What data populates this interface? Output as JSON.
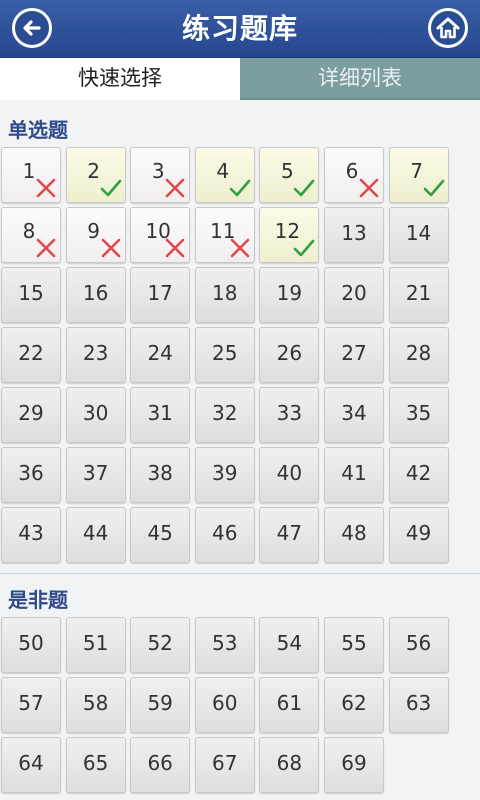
{
  "header": {
    "title": "练习题库",
    "back_icon": "back-arrow-icon",
    "home_icon": "home-icon"
  },
  "tabs": [
    {
      "label": "快速选择",
      "active": true
    },
    {
      "label": "详细列表",
      "active": false
    }
  ],
  "sections": [
    {
      "title": "单选题",
      "questions": [
        {
          "n": "1",
          "s": "wrong"
        },
        {
          "n": "2",
          "s": "right"
        },
        {
          "n": "3",
          "s": "wrong"
        },
        {
          "n": "4",
          "s": "right"
        },
        {
          "n": "5",
          "s": "right"
        },
        {
          "n": "6",
          "s": "wrong"
        },
        {
          "n": "7",
          "s": "right"
        },
        {
          "n": "8",
          "s": "wrong"
        },
        {
          "n": "9",
          "s": "wrong"
        },
        {
          "n": "10",
          "s": "wrong"
        },
        {
          "n": "11",
          "s": "wrong"
        },
        {
          "n": "12",
          "s": "right"
        },
        {
          "n": "13",
          "s": "none"
        },
        {
          "n": "14",
          "s": "none"
        },
        {
          "n": "15",
          "s": "none"
        },
        {
          "n": "16",
          "s": "none"
        },
        {
          "n": "17",
          "s": "none"
        },
        {
          "n": "18",
          "s": "none"
        },
        {
          "n": "19",
          "s": "none"
        },
        {
          "n": "20",
          "s": "none"
        },
        {
          "n": "21",
          "s": "none"
        },
        {
          "n": "22",
          "s": "none"
        },
        {
          "n": "23",
          "s": "none"
        },
        {
          "n": "24",
          "s": "none"
        },
        {
          "n": "25",
          "s": "none"
        },
        {
          "n": "26",
          "s": "none"
        },
        {
          "n": "27",
          "s": "none"
        },
        {
          "n": "28",
          "s": "none"
        },
        {
          "n": "29",
          "s": "none"
        },
        {
          "n": "30",
          "s": "none"
        },
        {
          "n": "31",
          "s": "none"
        },
        {
          "n": "32",
          "s": "none"
        },
        {
          "n": "33",
          "s": "none"
        },
        {
          "n": "34",
          "s": "none"
        },
        {
          "n": "35",
          "s": "none"
        },
        {
          "n": "36",
          "s": "none"
        },
        {
          "n": "37",
          "s": "none"
        },
        {
          "n": "38",
          "s": "none"
        },
        {
          "n": "39",
          "s": "none"
        },
        {
          "n": "40",
          "s": "none"
        },
        {
          "n": "41",
          "s": "none"
        },
        {
          "n": "42",
          "s": "none"
        },
        {
          "n": "43",
          "s": "none"
        },
        {
          "n": "44",
          "s": "none"
        },
        {
          "n": "45",
          "s": "none"
        },
        {
          "n": "46",
          "s": "none"
        },
        {
          "n": "47",
          "s": "none"
        },
        {
          "n": "48",
          "s": "none"
        },
        {
          "n": "49",
          "s": "none"
        }
      ]
    },
    {
      "title": "是非题",
      "questions": [
        {
          "n": "50",
          "s": "none"
        },
        {
          "n": "51",
          "s": "none"
        },
        {
          "n": "52",
          "s": "none"
        },
        {
          "n": "53",
          "s": "none"
        },
        {
          "n": "54",
          "s": "none"
        },
        {
          "n": "55",
          "s": "none"
        },
        {
          "n": "56",
          "s": "none"
        },
        {
          "n": "57",
          "s": "none"
        },
        {
          "n": "58",
          "s": "none"
        },
        {
          "n": "59",
          "s": "none"
        },
        {
          "n": "60",
          "s": "none"
        },
        {
          "n": "61",
          "s": "none"
        },
        {
          "n": "62",
          "s": "none"
        },
        {
          "n": "63",
          "s": "none"
        },
        {
          "n": "64",
          "s": "none"
        },
        {
          "n": "65",
          "s": "none"
        },
        {
          "n": "66",
          "s": "none"
        },
        {
          "n": "67",
          "s": "none"
        },
        {
          "n": "68",
          "s": "none"
        },
        {
          "n": "69",
          "s": "none"
        }
      ]
    }
  ],
  "colors": {
    "header": "#24478e",
    "correct": "#2ea043",
    "wrong": "#e0484f",
    "section_title": "#2f4a8a"
  }
}
